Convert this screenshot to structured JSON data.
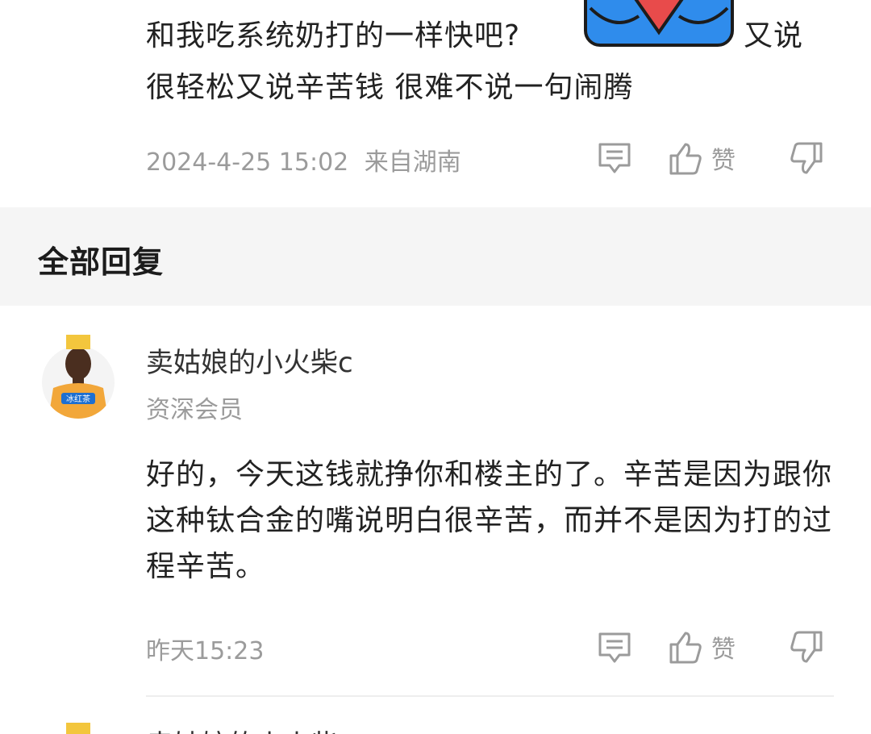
{
  "top_reply": {
    "text_line1": "和我吃系统奶打的一样快吧?",
    "text_line1_tail": "又说",
    "text_line2": "很轻松又说辛苦钱 很难不说一句闹腾",
    "timestamp": "2024-4-25 15:02",
    "location": "来自湖南",
    "like_label": "赞"
  },
  "section": {
    "title": "全部回复"
  },
  "reply": {
    "username": "卖姑娘的小火柴c",
    "badge": "资深会员",
    "text": "好的，今天这钱就挣你和楼主的了。辛苦是因为跟你这种钛合金的嘴说明白很辛苦，而并不是因为打的过程辛苦。",
    "timestamp": "昨天15:23",
    "like_label": "赞"
  },
  "next_reply": {
    "username": "卖姑娘的小火柴c"
  },
  "colors": {
    "meta_gray": "#9b9b9b",
    "section_bg": "#f5f5f5",
    "emoji_blue": "#2f8cec",
    "emoji_red": "#e84b4b",
    "jersey_orange": "#f2a73a"
  }
}
